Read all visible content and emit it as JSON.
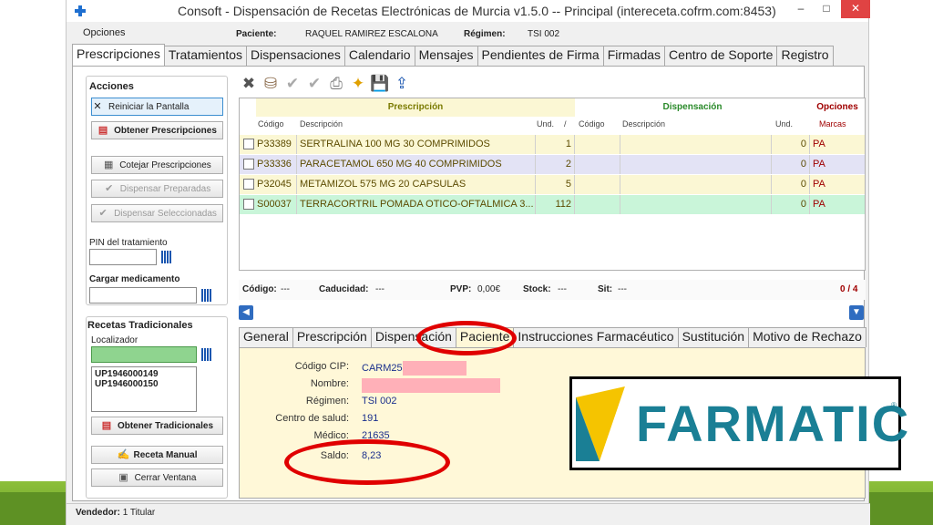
{
  "window": {
    "title": "Consoft - Dispensación de Recetas Electrónicas de Murcia v1.5.0   -- Principal (intereceta.cofrm.com:8453)",
    "min_label": "–",
    "max_label": "□",
    "close_label": "✕"
  },
  "menu": {
    "opciones": "Opciones"
  },
  "patient_header": {
    "paciente_label": "Paciente:",
    "paciente_value": "RAQUEL RAMIREZ ESCALONA",
    "regimen_label": "Régimen:",
    "regimen_value": "TSI 002"
  },
  "main_tabs": [
    {
      "label": "Prescripciones"
    },
    {
      "label": "Tratamientos"
    },
    {
      "label": "Dispensaciones"
    },
    {
      "label": "Calendario"
    },
    {
      "label": "Mensajes"
    },
    {
      "label": "Pendientes de Firma"
    },
    {
      "label": "Firmadas"
    },
    {
      "label": "Centro de Soporte"
    },
    {
      "label": "Registro"
    }
  ],
  "left_panel": {
    "acciones_title": "Acciones",
    "buttons": {
      "reiniciar": "Reiniciar la Pantalla",
      "obtener_prescripciones": "Obtener Prescripciones",
      "cotejar": "Cotejar Prescripciones",
      "dispensar_preparadas": "Dispensar Preparadas",
      "dispensar_seleccionadas": "Dispensar Seleccionadas"
    },
    "pin_label": "PIN del tratamiento",
    "cargar_label": "Cargar medicamento",
    "recetas_title": "Recetas Tradicionales",
    "localizador_label": "Localizador",
    "recetas_list": [
      "UP1946000149",
      "UP1946000150"
    ],
    "obtener_tradicionales": "Obtener Tradicionales",
    "receta_manual": "Receta Manual",
    "cerrar_ventana": "Cerrar Ventana"
  },
  "grid": {
    "group_headers": {
      "prescripcion": "Prescripción",
      "dispensacion": "Dispensación",
      "opciones": "Opciones"
    },
    "columns": {
      "codigo": "Código",
      "descripcion": "Descripción",
      "und": "Und.",
      "sort": "/",
      "codigo2": "Código",
      "descripcion2": "Descripción",
      "und2": "Und.",
      "marcas": "Marcas"
    },
    "rows": [
      {
        "codigo": "P33389",
        "descripcion": "SERTRALINA 100 MG 30 COMPRIMIDOS",
        "und": "1",
        "und2": "0",
        "marca": "PA"
      },
      {
        "codigo": "P33336",
        "descripcion": "PARACETAMOL 650 MG 40 COMPRIMIDOS",
        "und": "2",
        "und2": "0",
        "marca": "PA"
      },
      {
        "codigo": "P32045",
        "descripcion": "METAMIZOL 575 MG 20 CAPSULAS",
        "und": "5",
        "und2": "0",
        "marca": "PA"
      },
      {
        "codigo": "S00037",
        "descripcion": "TERRACORTRIL POMADA OTICO-OFTALMICA 3...",
        "und": "112",
        "und2": "0",
        "marca": "PA"
      }
    ]
  },
  "status_line": {
    "codigo": "Código:",
    "codigo_val": "---",
    "caducidad": "Caducidad:",
    "caducidad_val": "---",
    "pvp": "PVP:",
    "pvp_val": "0,00€",
    "stock": "Stock:",
    "stock_val": "---",
    "sit": "Sit:",
    "sit_val": "---",
    "count": "0 / 4"
  },
  "detail_tabs": [
    {
      "label": "General"
    },
    {
      "label": "Prescripción"
    },
    {
      "label": "Dispensación"
    },
    {
      "label": "Paciente"
    },
    {
      "label": "Instrucciones Farmacéutico"
    },
    {
      "label": "Sustitución"
    },
    {
      "label": "Motivo de Rechazo"
    }
  ],
  "patient_detail": {
    "codigo_cip_label": "Código CIP:",
    "codigo_cip_value": "CARM25",
    "nombre_label": "Nombre:",
    "nombre_value": "",
    "regimen_label": "Régimen:",
    "regimen_value": "TSI 002",
    "centro_label": "Centro de salud:",
    "centro_value": "191",
    "medico_label": "Médico:",
    "medico_value": "21635",
    "saldo_label": "Saldo:",
    "saldo_value": "8,23"
  },
  "logo": {
    "text": "FARMATIC",
    "reg": "®",
    "color_text": "#1a7f95",
    "color_mark": "#f5c400"
  },
  "statusbar": {
    "vendedor_label": "Vendedor:",
    "vendedor_value": "1 Titular"
  },
  "colors": {
    "row_yellow": "#fbf7d4",
    "row_lavender": "#e3e3f5",
    "row_green": "#c9f5d9",
    "highlight_red": "#e00000",
    "slide_green": "#6da02a"
  }
}
